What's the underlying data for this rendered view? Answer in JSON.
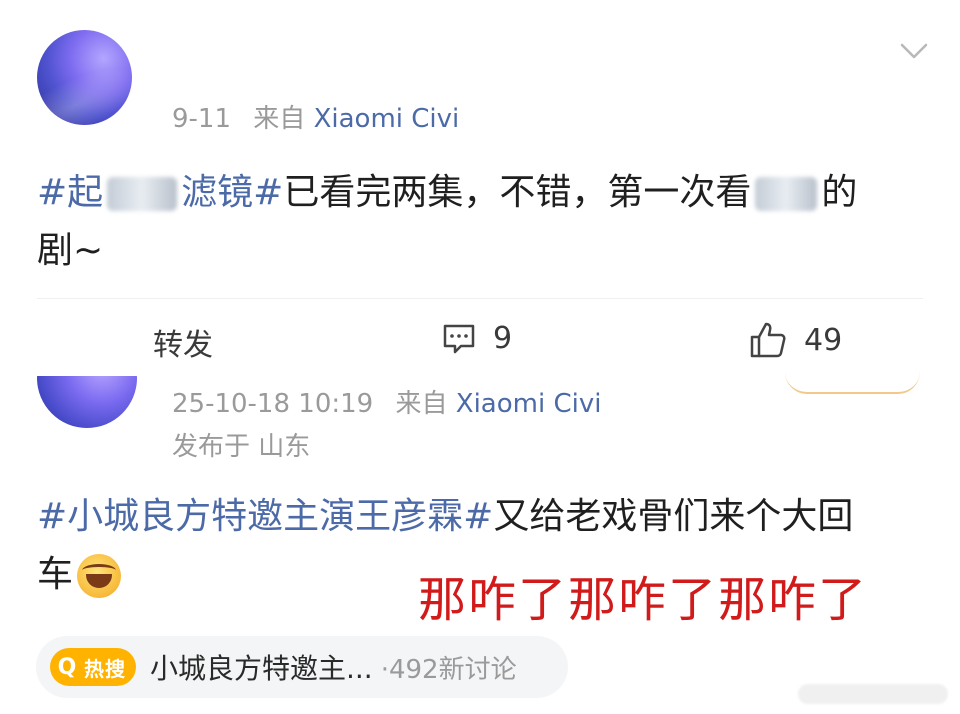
{
  "post1": {
    "meta_date": "9-11",
    "meta_from": "来自",
    "meta_device": "Xiaomi Civi",
    "content": {
      "hashtag_prefix": "#起",
      "hashtag_suffix": "滤镜#",
      "text1": "已看完两集，不错，第一次看",
      "text2": "的",
      "text3": "剧~"
    },
    "actions": {
      "repost_label": "转发",
      "comment_count": "9",
      "like_count": "49"
    }
  },
  "post2": {
    "meta_datetime": "25-10-18 10:19",
    "meta_from": "来自",
    "meta_device": "Xiaomi Civi",
    "location": "发布于 山东",
    "content": {
      "hashtag": "#小城良方特邀主演王彦霖#",
      "text1": "又给老戏骨们来个大回",
      "text2": "车"
    },
    "overlay_text": "那咋了那咋了那咋了",
    "hot": {
      "badge": "热搜",
      "title": "小城良方特邀主...",
      "count": "·492新讨论"
    }
  }
}
